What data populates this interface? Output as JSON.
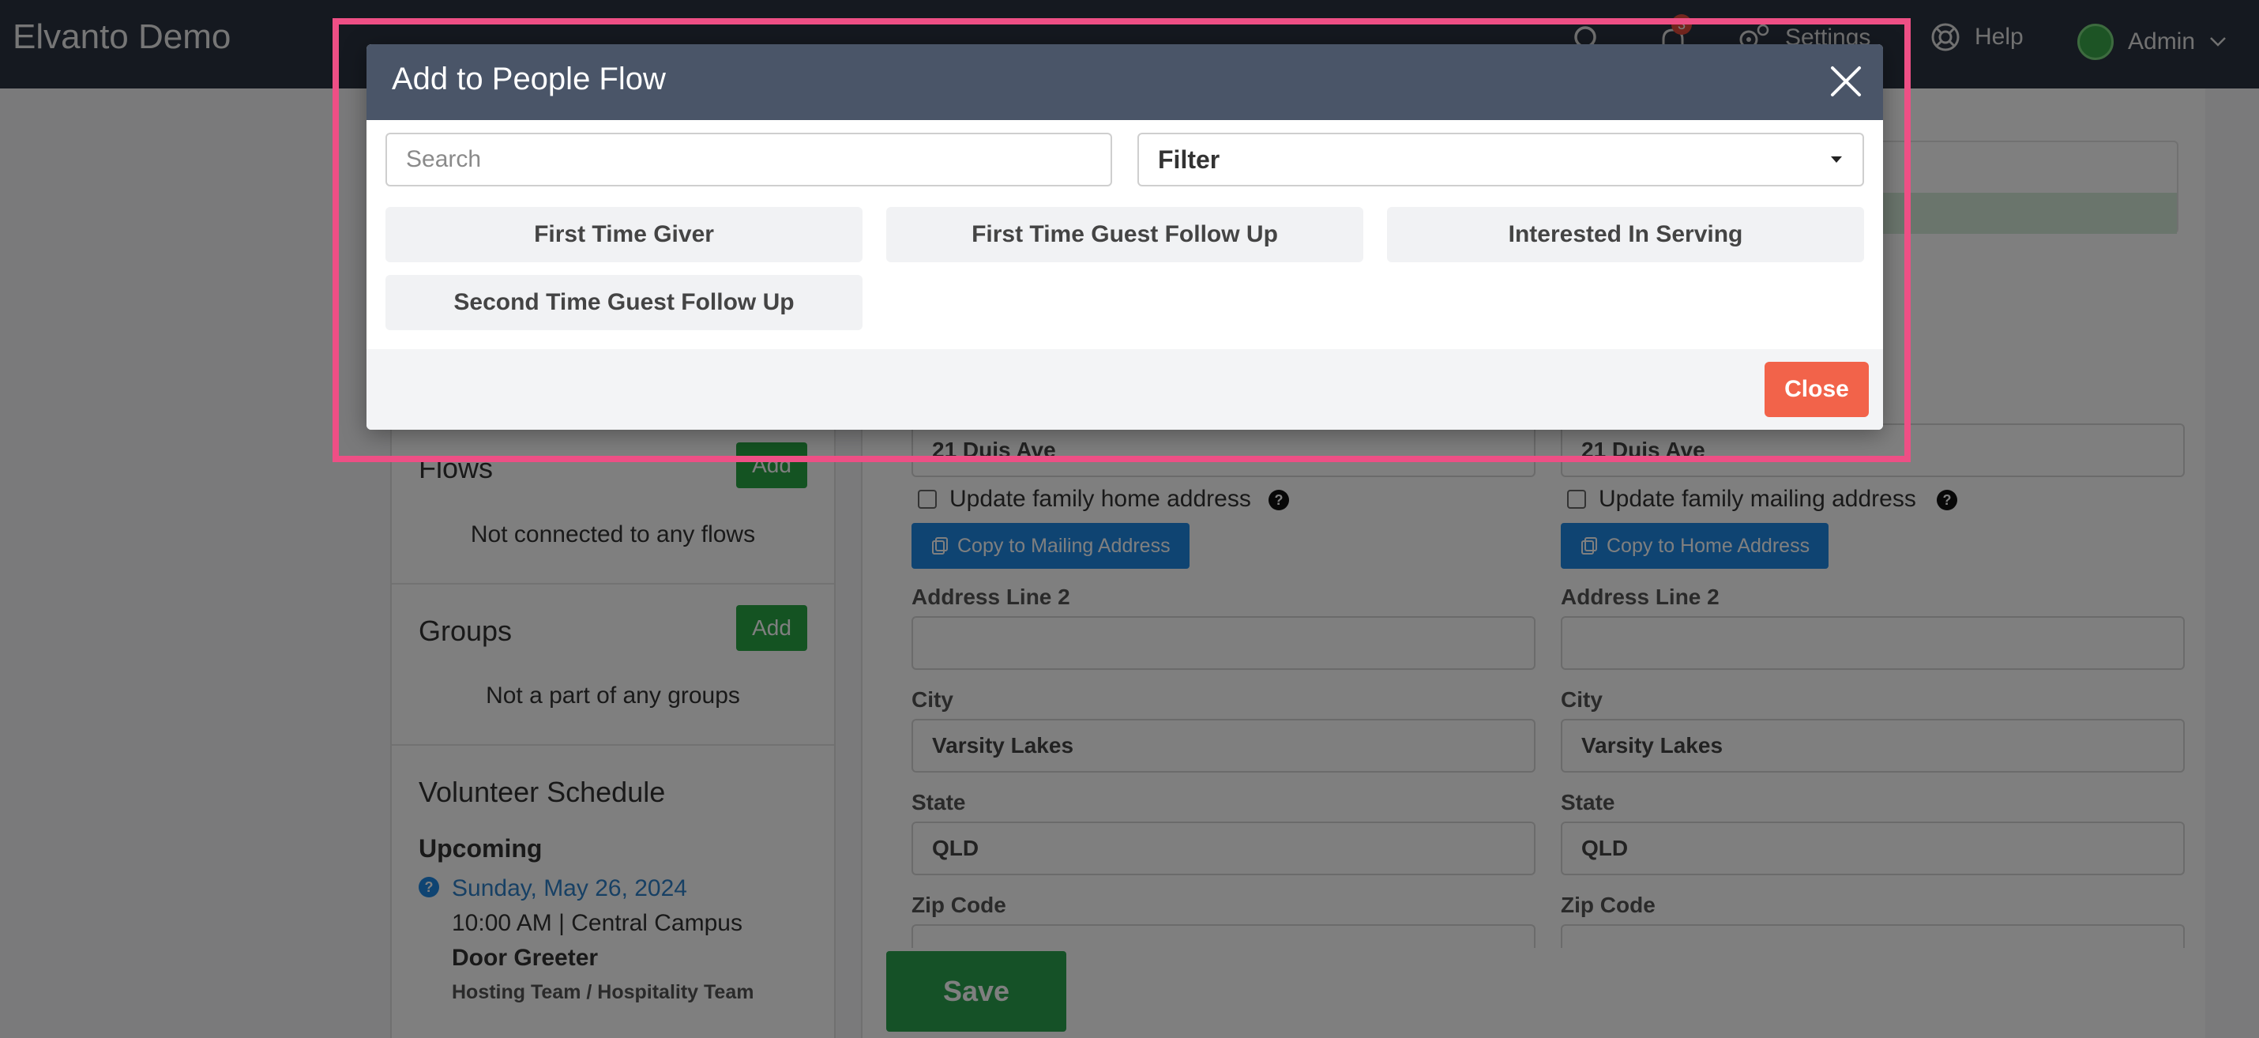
{
  "topbar": {
    "brand": "Elvanto Demo",
    "settings_label": "Settings",
    "help_label": "Help",
    "user_label": "Admin",
    "notification_count": "3"
  },
  "left": {
    "flows": {
      "title": "Flows",
      "add_label": "Add",
      "empty": "Not connected to any flows"
    },
    "groups": {
      "title": "Groups",
      "add_label": "Add",
      "empty": "Not a part of any groups"
    },
    "schedule": {
      "title": "Volunteer Schedule",
      "upcoming_label": "Upcoming",
      "date": "Sunday, May 26, 2024",
      "time_location": "10:00 AM | Central Campus",
      "position": "Door Greeter",
      "team": "Hosting Team / Hospitality Team"
    }
  },
  "address": {
    "home": {
      "line1": "21 Duis Ave",
      "update_label": "Update family home address",
      "copy_label": "Copy to Mailing Address",
      "line2_label": "Address Line 2",
      "line2_value": "",
      "city_label": "City",
      "city_value": "Varsity Lakes",
      "state_label": "State",
      "state_value": "QLD",
      "zip_label": "Zip Code"
    },
    "mailing": {
      "line1": "21 Duis Ave",
      "update_label": "Update family mailing address",
      "copy_label": "Copy to Home Address",
      "line2_label": "Address Line 2",
      "line2_value": "",
      "city_label": "City",
      "city_value": "Varsity Lakes",
      "state_label": "State",
      "state_value": "QLD",
      "zip_label": "Zip Code"
    }
  },
  "save_label": "Save",
  "modal": {
    "title": "Add to People Flow",
    "search_placeholder": "Search",
    "filter_label": "Filter",
    "flows": [
      "First Time Giver",
      "First Time Guest Follow Up",
      "Interested In Serving",
      "Second Time Guest Follow Up"
    ],
    "close_label": "Close"
  },
  "colors": {
    "modal_header": "#4a5568",
    "close_button": "#f2634a",
    "add_button": "#28a745",
    "copy_button": "#1e88e5",
    "highlight": "#ee4f85"
  }
}
